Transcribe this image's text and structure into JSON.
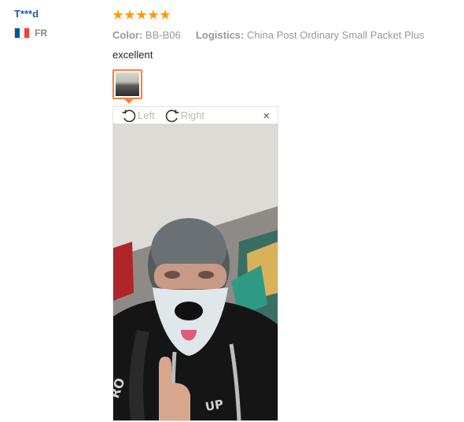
{
  "review": {
    "username": "T***d",
    "country_code": "FR",
    "rating": 5,
    "color_label": "Color:",
    "color_value": "BB-B06",
    "logistics_label": "Logistics:",
    "logistics_value": "China Post Ordinary Small Packet Plus",
    "text": "excellent"
  },
  "viewer": {
    "rotate_left_label": "Left",
    "rotate_right_label": "Right",
    "close_label": "×"
  },
  "colors": {
    "username": "#1a5fb4",
    "star": "#ff9a00",
    "thumb_border": "#ff7e33",
    "flag_blue": "#0055a4",
    "flag_white": "#ffffff",
    "flag_red": "#ef4135"
  },
  "icons": {
    "rotate_left": "rotate-left-icon",
    "rotate_right": "rotate-right-icon",
    "close": "close-icon",
    "flag": "france-flag-icon",
    "star": "star-icon"
  }
}
